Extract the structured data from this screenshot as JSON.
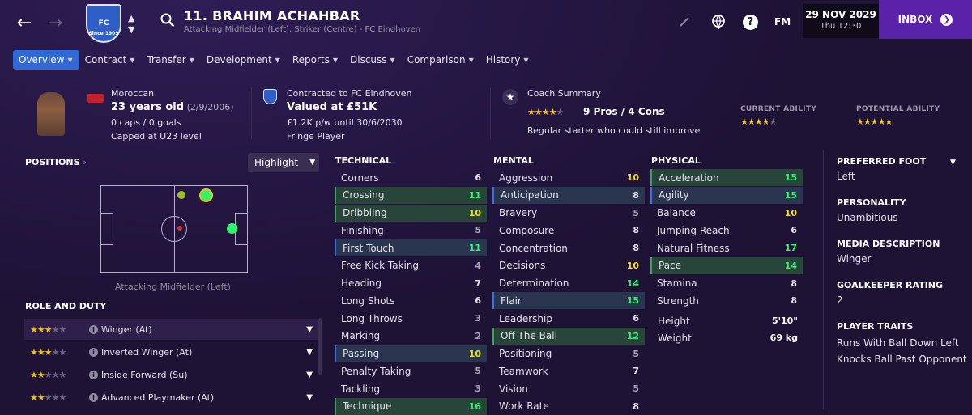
{
  "header": {
    "back_icon": "arrow-left-icon",
    "forward_icon": "arrow-right-icon",
    "club_crest_text": "FC",
    "club_crest_sub": "Since 1909",
    "player_name": "11. BRAHIM ACHAHBAR",
    "player_subtitle": "Attacking Midfielder (Left), Striker (Centre) - FC Eindhoven",
    "date": "29 NOV 2029",
    "day_time": "Thu 12:30",
    "fm_label": "FM",
    "inbox_label": "INBOX"
  },
  "tabs": [
    {
      "label": "Overview"
    },
    {
      "label": "Contract"
    },
    {
      "label": "Transfer"
    },
    {
      "label": "Development"
    },
    {
      "label": "Reports"
    },
    {
      "label": "Discuss"
    },
    {
      "label": "Comparison"
    },
    {
      "label": "History"
    }
  ],
  "info": {
    "nationality": "Moroccan",
    "age": "23 years old",
    "dob": "(2/9/2006)",
    "caps": "0 caps / 0 goals",
    "capped": "Capped at U23 level",
    "contract": "Contracted to FC Eindhoven",
    "value": "Valued at £51K",
    "wage": "£1.2K p/w until 30/6/2030",
    "squad_status": "Fringe Player",
    "coach_title": "Coach Summary",
    "coach_rating_stars": 3.5,
    "pros_cons": "9 Pros / 4 Cons",
    "coach_note": "Regular starter who could still improve",
    "current_ability_label": "CURRENT ABILITY",
    "current_ability_stars": 3.5,
    "potential_ability_label": "POTENTIAL ABILITY",
    "potential_ability_stars": 4.5
  },
  "positions": {
    "title": "POSITIONS",
    "highlight_label": "Highlight",
    "caption": "Attacking Midfielder (Left)"
  },
  "roles": {
    "title": "ROLE AND DUTY",
    "items": [
      {
        "stars": 3.5,
        "label": "Winger (At)"
      },
      {
        "stars": 3,
        "label": "Inverted Winger (At)"
      },
      {
        "stars": 2.5,
        "label": "Inside Forward (Su)"
      },
      {
        "stars": 2.5,
        "label": "Advanced Playmaker (At)"
      }
    ]
  },
  "technical": {
    "title": "TECHNICAL",
    "items": [
      {
        "name": "Corners",
        "value": "6",
        "hl": ""
      },
      {
        "name": "Crossing",
        "value": "11",
        "hl": "green"
      },
      {
        "name": "Dribbling",
        "value": "10",
        "hl": "green"
      },
      {
        "name": "Finishing",
        "value": "5",
        "hl": ""
      },
      {
        "name": "First Touch",
        "value": "11",
        "hl": "blue"
      },
      {
        "name": "Free Kick Taking",
        "value": "4",
        "hl": ""
      },
      {
        "name": "Heading",
        "value": "7",
        "hl": ""
      },
      {
        "name": "Long Shots",
        "value": "6",
        "hl": ""
      },
      {
        "name": "Long Throws",
        "value": "3",
        "hl": ""
      },
      {
        "name": "Marking",
        "value": "2",
        "hl": ""
      },
      {
        "name": "Passing",
        "value": "10",
        "hl": "blue"
      },
      {
        "name": "Penalty Taking",
        "value": "5",
        "hl": ""
      },
      {
        "name": "Tackling",
        "value": "3",
        "hl": ""
      },
      {
        "name": "Technique",
        "value": "16",
        "hl": "green"
      }
    ]
  },
  "mental": {
    "title": "MENTAL",
    "items": [
      {
        "name": "Aggression",
        "value": "10",
        "hl": ""
      },
      {
        "name": "Anticipation",
        "value": "8",
        "hl": "blue"
      },
      {
        "name": "Bravery",
        "value": "5",
        "hl": ""
      },
      {
        "name": "Composure",
        "value": "8",
        "hl": ""
      },
      {
        "name": "Concentration",
        "value": "8",
        "hl": ""
      },
      {
        "name": "Decisions",
        "value": "10",
        "hl": ""
      },
      {
        "name": "Determination",
        "value": "14",
        "hl": ""
      },
      {
        "name": "Flair",
        "value": "15",
        "hl": "blue"
      },
      {
        "name": "Leadership",
        "value": "6",
        "hl": ""
      },
      {
        "name": "Off The Ball",
        "value": "12",
        "hl": "green"
      },
      {
        "name": "Positioning",
        "value": "5",
        "hl": ""
      },
      {
        "name": "Teamwork",
        "value": "7",
        "hl": ""
      },
      {
        "name": "Vision",
        "value": "5",
        "hl": ""
      },
      {
        "name": "Work Rate",
        "value": "8",
        "hl": ""
      }
    ]
  },
  "physical": {
    "title": "PHYSICAL",
    "items": [
      {
        "name": "Acceleration",
        "value": "15",
        "hl": "green"
      },
      {
        "name": "Agility",
        "value": "15",
        "hl": "blue"
      },
      {
        "name": "Balance",
        "value": "10",
        "hl": ""
      },
      {
        "name": "Jumping Reach",
        "value": "6",
        "hl": ""
      },
      {
        "name": "Natural Fitness",
        "value": "17",
        "hl": ""
      },
      {
        "name": "Pace",
        "value": "14",
        "hl": "green"
      },
      {
        "name": "Stamina",
        "value": "8",
        "hl": ""
      },
      {
        "name": "Strength",
        "value": "8",
        "hl": ""
      }
    ],
    "height_label": "Height",
    "height_value": "5'10\"",
    "weight_label": "Weight",
    "weight_value": "69 kg"
  },
  "side": {
    "foot_label": "PREFERRED FOOT",
    "foot_value": "Left",
    "personality_label": "PERSONALITY",
    "personality_value": "Unambitious",
    "media_label": "MEDIA DESCRIPTION",
    "media_value": "Winger",
    "gk_label": "GOALKEEPER RATING",
    "gk_value": "2",
    "traits_label": "PLAYER TRAITS",
    "traits": [
      "Runs With Ball Down Left",
      "Knocks Ball Past Opponent"
    ]
  },
  "colors": {
    "accent": "#2f6ad8",
    "inbox": "#5a22a8",
    "high": "#2ef56a",
    "mid": "#f0e020"
  }
}
